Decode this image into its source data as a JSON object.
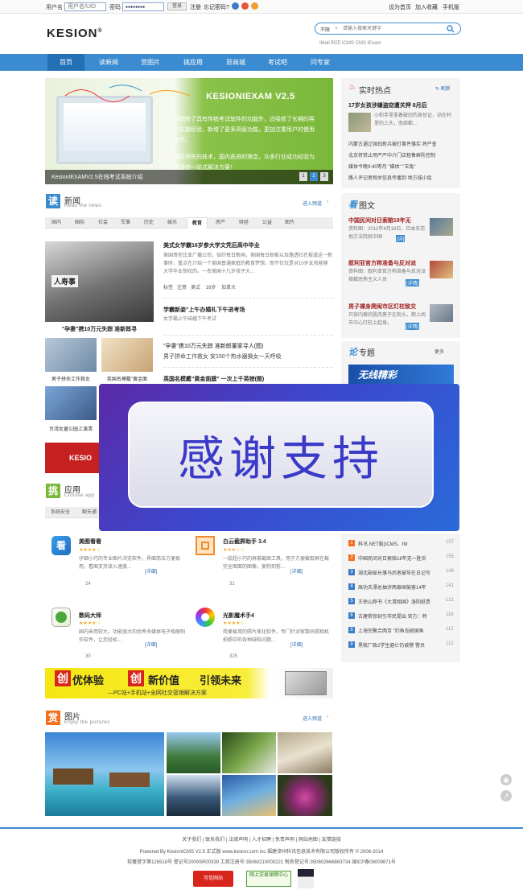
{
  "colors": {
    "nav_blue": "#3b8bd0",
    "nav_active": "#2370b5",
    "accent_orange": "#f37021",
    "brand_black": "#222222"
  },
  "topbar": {
    "username_label": "用户名",
    "username_placeholder": "用户名/UID",
    "password_label": "密码",
    "password_value": "●●●●●●●●",
    "login_button": "登录",
    "register": "注册",
    "forgot": "忘记密码?",
    "right_links": [
      "设为首页",
      "加入收藏",
      "手机版"
    ]
  },
  "header": {
    "logo": "KESION",
    "logo_reg": "®",
    "search_scope": "不限",
    "search_placeholder": "请输入搜索关键字",
    "search_hint": "IMall 科讯 ICMS CMS IExam"
  },
  "nav": {
    "items": [
      "首页",
      "读新闻",
      "赏图片",
      "挑应用",
      "逛商城",
      "考试吧",
      "问专家"
    ],
    "active_index": 0
  },
  "banner": {
    "product": "KESIONIEXAM V2.5",
    "text1": "系统除了具有传统考试软件的功能外，还吸收了长期的客户实施经验，新增了更多高级功能，更加注重用户的使用细节。",
    "text2": "国际领先的技术，国内逃进的理念，众多行业成功经验为您提供一站式解决方案！",
    "caption": "KesionIEXAMV2.5在线考试系统介绍",
    "pager": [
      "1",
      "2",
      "3"
    ]
  },
  "hot": {
    "title": "实时热点",
    "refresh": "刷新",
    "headline": "17岁女孩涉嫌盗窃遭关押 8月后",
    "headline_desc": "小和手里拿着破旧的身份证，站在村里的上头，南部都...",
    "items": [
      "内蒙古通辽强劲新兵被打事件落实 将严查",
      "北京将禁止用严严中介门店租售群防控制",
      "媒体今晚9:40等月 \"媒体\" \"玉兔\"",
      "路人评记者相关信息传播到 地方城小组"
    ]
  },
  "tuwen": {
    "icon": "看",
    "title": "图文",
    "items": [
      {
        "title": "中国民间对日索赔18年无",
        "desc": "资料图：2012年4月18日，日本东京地方法院就中国",
        "tag": "[详]"
      },
      {
        "title": "叙利亚官方称准备与反对派",
        "desc": "资料图：叙利亚官方称准备与反对派接触恐怖主义人员",
        "tag": "[详情]"
      },
      {
        "title": "男子裸身爬闹市区灯柱致交",
        "desc": "只穿内裤的肌肉男子在街头，爬上闹市中心灯柱上起身。",
        "tag": "[详情]"
      }
    ]
  },
  "zhuanti": {
    "icon": "论",
    "title": "专题",
    "more": "更多",
    "banner_text": "无线精彩"
  },
  "news": {
    "icon": "读",
    "title": "新闻",
    "subtitle": "Read the news",
    "more": "进入频道",
    "tabs": [
      "国内",
      "国际",
      "社会",
      "军事",
      "历史",
      "娱乐",
      "教育",
      "房产",
      "财经",
      "公益",
      "图片"
    ],
    "active_tab": 6,
    "feature_caption": "\"孕妻\"携10万元失踪 准新郎寻",
    "photo_badge": "人寿事",
    "articles": [
      {
        "title": "美式女学霸16岁参大学文凭后高中毕业",
        "desc": "美国哥伦比亚广播公司，倍约每日新闻，美国每日邮报以及路透社在报道这一新事时，重点在介绍一个美国普通家庭的教育梦想，而不仅仅是对10岁女孩能够大学毕业惊叹的。一名美国十几岁孩子大...",
        "tags": [
          "标签",
          "注意",
          "美式",
          "16岁",
          "加拿大"
        ]
      },
      {
        "title": "学霸新姿\"上午办婚礼下午进考场",
        "desc": "女学霸上午结婚下午考试"
      },
      {
        "title": "\"孕妻\"携10万元失踪 准新郎董家寻人(图)",
        "desc": "男子拼命工作救女 安150个热水器换女一天呼吸"
      },
      {
        "title": "英国名模戴\"黄金面膜\" 一次上千英镑(图)",
        "desc": ""
      }
    ],
    "thumbs": [
      "男子拼命工作救女",
      "英国名模戴\"黄金面",
      "台湾女童公园上演清"
    ]
  },
  "apps": {
    "icon": "挑",
    "title": "应用",
    "subtitle": "Choose app",
    "tabs": [
      "系统安全",
      "聊天通"
    ],
    "list": [
      {
        "name": "美图看看",
        "stars": "★★★★☆",
        "desc": "仔细小巧的专业图片浏览软件，界面简洁方便易用，看图支持读入速度...",
        "count": "24",
        "detail": "[详细]"
      },
      {
        "name": "白云截屏助手 3.4",
        "stars": "★★★☆☆",
        "desc": "一款超小巧的屏幕截图工具，用于方便截取屏在截完全图面的图像，复制到剪...",
        "count": "31",
        "detail": "[详细]"
      },
      {
        "name": "数码大师",
        "stars": "★★★★☆",
        "desc": "国内来用较大。功能强大的优秀多媒体电子相册制作软件，让您轻松...",
        "count": "30",
        "detail": "[详细]"
      },
      {
        "name": "光影魔术手4",
        "stars": "★★★★☆",
        "desc": "简便易用的照片美化软件，专门针对家数码照相机拍照中的各种缺陷问题...",
        "count": "325",
        "detail": "[详细]"
      }
    ]
  },
  "ranking": {
    "items": [
      {
        "title": "科讯.NET版(ICMS、IM",
        "count": "157"
      },
      {
        "title": "中国民间对日索赔18年无一胜诉",
        "count": "155"
      },
      {
        "title": "湖北副省长落马后者被导在日记写",
        "count": "148"
      },
      {
        "title": "高功夫漂总抽涉两泰国偷客14年",
        "count": "141"
      },
      {
        "title": "王徐山荐书《大清相国》洛阳纸贵",
        "count": "121"
      },
      {
        "title": "古建筑惊刻引市民提出 官方：特",
        "count": "116"
      },
      {
        "title": "上海完聚合两百 \"约鱼岛砸国鱼",
        "count": "112"
      },
      {
        "title": "黑梳厂致2学生避亡仍被警 警员",
        "count": "112"
      }
    ]
  },
  "ad": {
    "c1": "创",
    "w1": "优体验",
    "c2": "创",
    "w2": "新价值",
    "w3": "引领未来",
    "sub": "—PC站+手机站+全网社交营销解决方案"
  },
  "pics": {
    "icon": "赏",
    "title": "图片",
    "subtitle": "Enjoy the pictures",
    "more": "进入频道"
  },
  "overlay": {
    "text": "感谢支持"
  },
  "footer": {
    "links": [
      "关于我们",
      "联系我们",
      "法律声明",
      "人才招聘",
      "免责声明",
      "网站地图",
      "友情链接"
    ],
    "line1": "Powered By KesionICMS V2.5 正式版  www.kesion.com inc.福建漳州科讯信息技术有限公司版权所有 © 2006-2014",
    "line2": "软著登字第126518号 登记号2009SR00339 工商注册号:35060210000221 税务登记号:350602666863734 闽ICP备06009871号",
    "badges": [
      "可信网站",
      "网上交易保障中心"
    ]
  }
}
